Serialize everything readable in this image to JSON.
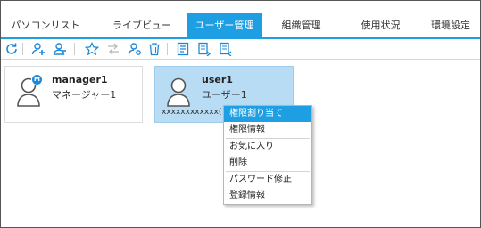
{
  "tabs": [
    {
      "label": "パソコンリスト",
      "active": false
    },
    {
      "label": "ライブビュー",
      "active": false
    },
    {
      "label": "ユーザー管理",
      "active": true
    },
    {
      "label": "組織管理",
      "active": false
    },
    {
      "label": "使用状況",
      "active": false
    },
    {
      "label": "環境設定",
      "active": false
    }
  ],
  "toolbar_icons": [
    "refresh-icon",
    "add-user-icon",
    "add-user-alt-icon",
    "favorite-icon",
    "swap-icon",
    "user-settings-icon",
    "delete-icon",
    "info-icon",
    "export-icon",
    "import-icon"
  ],
  "users": [
    {
      "name": "manager1",
      "display_name": "マネージャー1",
      "badge": "M",
      "selected": false
    },
    {
      "name": "user1",
      "display_name": "ユーザー1",
      "code": "xxxxxxxxxxxx(",
      "selected": true
    }
  ],
  "context_menu": {
    "items": [
      {
        "label": "権限割り当て",
        "highlighted": true
      },
      {
        "label": "権限情報"
      },
      {
        "label": "お気に入り"
      },
      {
        "label": "削除"
      },
      {
        "label": "パスワード修正"
      },
      {
        "label": "登録情報"
      }
    ]
  },
  "colors": {
    "accent": "#1e9fe3",
    "selected_card": "#b9dcf5",
    "badge": "#1e88d8"
  }
}
